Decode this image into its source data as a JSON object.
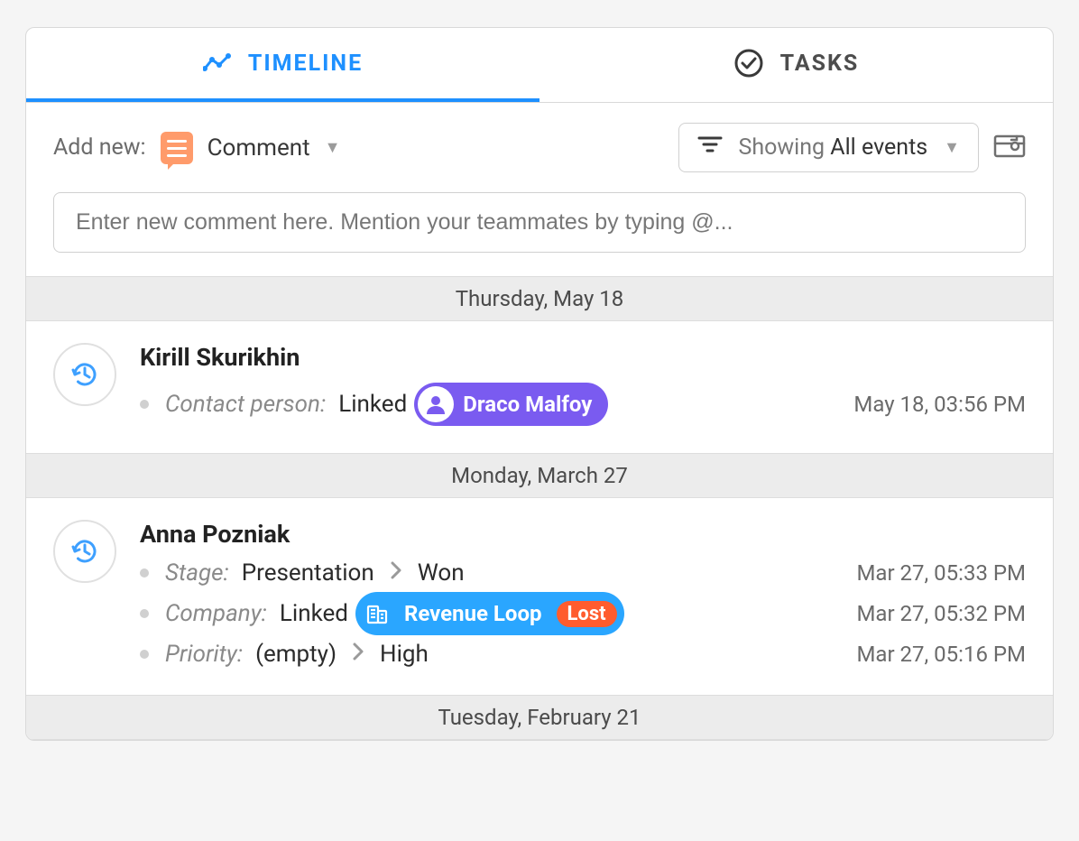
{
  "tabs": {
    "timeline": "TIMELINE",
    "tasks": "TASKS"
  },
  "controls": {
    "addnew_label": "Add new:",
    "addnew_type": "Comment",
    "filter_showing": "Showing",
    "filter_value": "All events"
  },
  "comment_placeholder": "Enter new comment here. Mention your teammates by typing @...",
  "groups": [
    {
      "date": "Thursday, May 18",
      "entries": [
        {
          "author": "Kirill Skurikhin",
          "rows": [
            {
              "field": "Contact person:",
              "text_before": "Linked",
              "pill": {
                "kind": "person",
                "label": "Draco Malfoy",
                "color": "purple"
              },
              "timestamp": "May 18, 03:56 PM"
            }
          ]
        }
      ]
    },
    {
      "date": "Monday, March 27",
      "entries": [
        {
          "author": "Anna Pozniak",
          "rows": [
            {
              "field": "Stage:",
              "from": "Presentation",
              "to": "Won",
              "timestamp": "Mar 27, 05:33 PM"
            },
            {
              "field": "Company:",
              "text_before": "Linked",
              "pill": {
                "kind": "company",
                "label": "Revenue Loop",
                "color": "blue",
                "tag": "Lost"
              },
              "timestamp": "Mar 27, 05:32 PM"
            },
            {
              "field": "Priority:",
              "from": "(empty)",
              "to": "High",
              "timestamp": "Mar 27, 05:16 PM"
            }
          ]
        }
      ]
    },
    {
      "date": "Tuesday, February 21",
      "entries": []
    }
  ]
}
